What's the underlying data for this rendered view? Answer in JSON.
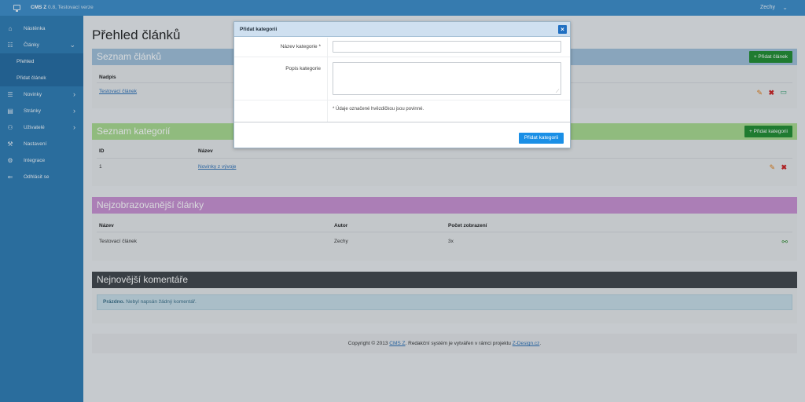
{
  "topbar": {
    "brand_name": "CMS Z",
    "brand_suffix": " 0.8, Testovací verze",
    "user": "Zechy"
  },
  "sidebar": {
    "items": [
      {
        "label": "Nástěnka",
        "icon": "home-icon",
        "glyph": "⌂"
      },
      {
        "label": "Články",
        "icon": "list-icon",
        "glyph": "☷"
      },
      {
        "label": "Přehled"
      },
      {
        "label": "Přidat článek"
      },
      {
        "label": "Novinky",
        "icon": "lines-icon",
        "glyph": "☰"
      },
      {
        "label": "Stránky",
        "icon": "page-icon",
        "glyph": "▤"
      },
      {
        "label": "Uživatelé",
        "icon": "users-icon",
        "glyph": "⚇"
      },
      {
        "label": "Nastavení",
        "icon": "wrench-icon",
        "glyph": "⚒"
      },
      {
        "label": "Integrace",
        "icon": "gear-icon",
        "glyph": "⚙"
      },
      {
        "label": "Odhlásit se",
        "icon": "logout-icon",
        "glyph": "⇐"
      }
    ]
  },
  "page_title": "Přehled článků",
  "articles_panel": {
    "title": "Seznam článků",
    "add_button": "+ Přidat článek",
    "header": "Nadpis",
    "rows": [
      {
        "title": "Testovací článek"
      }
    ]
  },
  "categories_panel": {
    "title": "Seznam kategorií",
    "add_button": "+ Přidat kategorii",
    "headers": {
      "id": "ID",
      "name": "Název"
    },
    "rows": [
      {
        "id": "1",
        "name": "Novinky z vývoje"
      }
    ]
  },
  "popular_panel": {
    "title": "Nejzobrazovanější články",
    "headers": {
      "name": "Název",
      "author": "Autor",
      "views": "Počet zobrazení"
    },
    "rows": [
      {
        "name": "Testovací článek",
        "author": "Zechy",
        "views": "3x"
      }
    ]
  },
  "comments_panel": {
    "title": "Nejnovější komentáře",
    "empty_bold": "Prázdno.",
    "empty_text": " Nebyl napsán žádný komentář."
  },
  "footer": {
    "prefix": "Copyright © 2013 ",
    "cms_link": "CMS Z",
    "middle": ". Redakční systém je vytvářen v rámci projektu ",
    "project_link": "Z-Design.cz",
    "suffix": "."
  },
  "modal": {
    "title": "Přidat kategorii",
    "close": "×",
    "name_label": "Název kategorie *",
    "name_value": "",
    "desc_label": "Popis kategorie",
    "desc_value": "",
    "note": "* Údaje označené hvězdičkou jsou povinné.",
    "submit": "Přidat kategorii"
  },
  "colors": {
    "topbar": "#3a8cc9",
    "sidebar": "#2b7ab3",
    "articles_head": "#9fbfd8",
    "categories_head": "#a8d98d",
    "popular_head": "#c98fd1",
    "comments_head": "#3e4347",
    "btn_green": "#1e8c2e",
    "btn_blue": "#1a8fe6"
  }
}
